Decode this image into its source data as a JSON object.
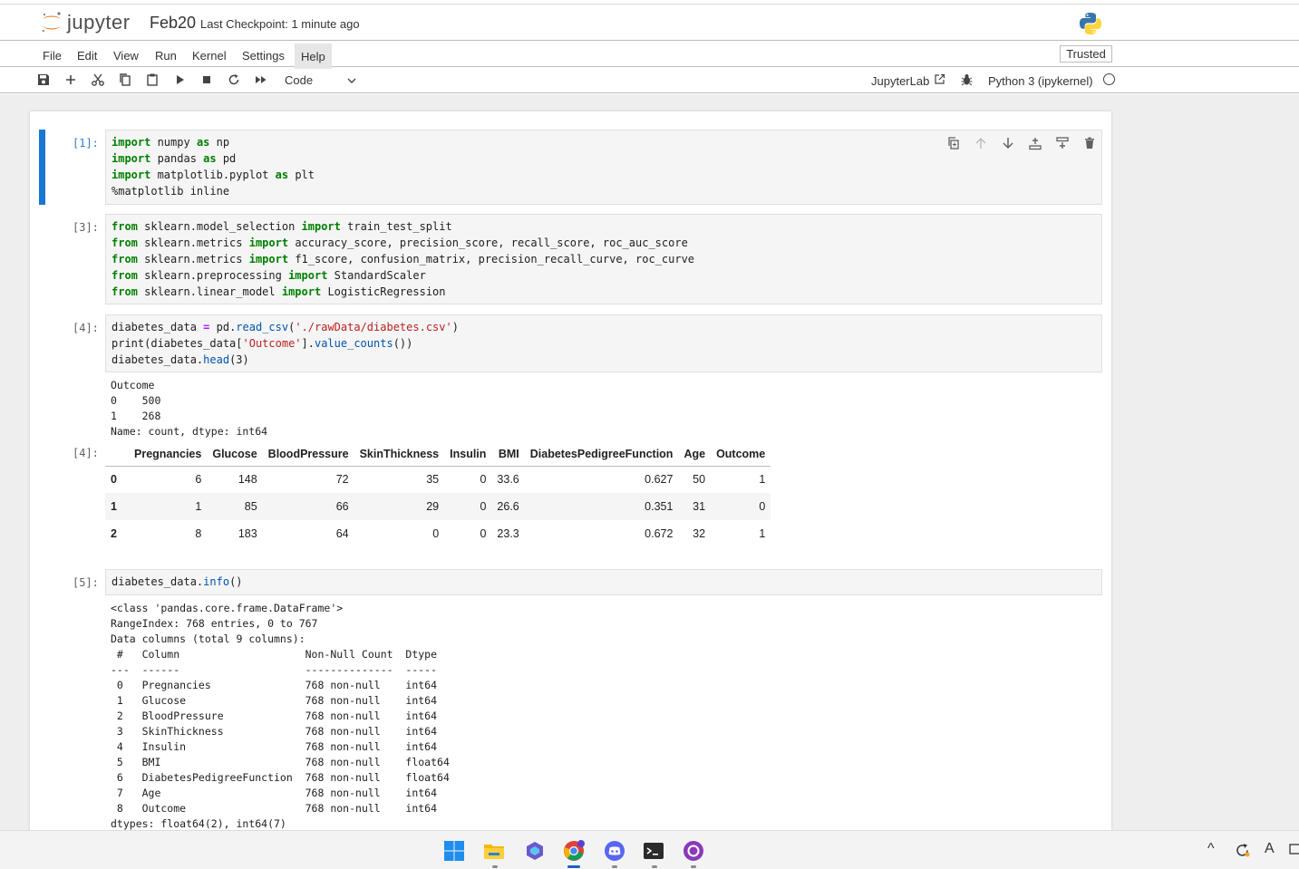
{
  "header": {
    "logo_text": "jupyter",
    "notebook_title": "Feb20",
    "checkpoint": "Last Checkpoint: 1 minute ago"
  },
  "menu": {
    "items": [
      "File",
      "Edit",
      "View",
      "Run",
      "Kernel",
      "Settings",
      "Help"
    ],
    "trusted": "Trusted"
  },
  "toolbar": {
    "cell_type": "Code",
    "jupyterlab_label": "JupyterLab",
    "kernel": "Python 3 (ipykernel)",
    "icons": [
      "save-icon",
      "add-icon",
      "cut-icon",
      "copy-icon",
      "paste-icon",
      "run-icon",
      "stop-icon",
      "restart-icon",
      "fast-forward-icon"
    ]
  },
  "cells": {
    "c1": {
      "prompt": "[1]:",
      "lines": {
        "l1": {
          "a": "import",
          "b": " numpy ",
          "c": "as",
          "d": " np"
        },
        "l2": {
          "a": "import",
          "b": " pandas ",
          "c": "as",
          "d": " pd"
        },
        "l3": {
          "a": "import",
          "b": " matplotlib.pyplot ",
          "c": "as",
          "d": " plt"
        },
        "l4": "%matplotlib inline"
      }
    },
    "c3": {
      "prompt": "[3]:",
      "lines": [
        {
          "from": "from",
          "mod": " sklearn.model_selection ",
          "imp": "import",
          "rest": " train_test_split"
        },
        {
          "from": "from",
          "mod": " sklearn.metrics ",
          "imp": "import",
          "rest": " accuracy_score, precision_score, recall_score, roc_auc_score"
        },
        {
          "from": "from",
          "mod": " sklearn.metrics ",
          "imp": "import",
          "rest": " f1_score, confusion_matrix, precision_recall_curve, roc_curve"
        },
        {
          "from": "from",
          "mod": " sklearn.preprocessing ",
          "imp": "import",
          "rest": " StandardScaler"
        },
        {
          "from": "from",
          "mod": " sklearn.linear_model ",
          "imp": "import",
          "rest": " LogisticRegression"
        }
      ]
    },
    "c4": {
      "prompt": "[4]:",
      "line1": {
        "a": "diabetes_data ",
        "op": "=",
        "b": " pd.",
        "fn": "read_csv",
        "c": "(",
        "str": "'./rawData/diabetes.csv'",
        "d": ")"
      },
      "line2": {
        "a": "print(diabetes_data[",
        "str": "'Outcome'",
        "b": "].",
        "fn": "value_counts",
        "c": "())"
      },
      "line3": {
        "a": "diabetes_data.",
        "fn": "head",
        "b": "(3)"
      },
      "stdout": "Outcome\n0    500\n1    268\nName: count, dtype: int64",
      "out_prompt": "[4]:",
      "table": {
        "columns": [
          "",
          "Pregnancies",
          "Glucose",
          "BloodPressure",
          "SkinThickness",
          "Insulin",
          "BMI",
          "DiabetesPedigreeFunction",
          "Age",
          "Outcome"
        ],
        "rows": [
          [
            "0",
            "6",
            "148",
            "72",
            "35",
            "0",
            "33.6",
            "0.627",
            "50",
            "1"
          ],
          [
            "1",
            "1",
            "85",
            "66",
            "29",
            "0",
            "26.6",
            "0.351",
            "31",
            "0"
          ],
          [
            "2",
            "8",
            "183",
            "64",
            "0",
            "0",
            "23.3",
            "0.672",
            "32",
            "1"
          ]
        ]
      }
    },
    "c5": {
      "prompt": "[5]:",
      "line1": {
        "a": "diabetes_data.",
        "fn": "info",
        "b": "()"
      },
      "stdout": "<class 'pandas.core.frame.DataFrame'>\nRangeIndex: 768 entries, 0 to 767\nData columns (total 9 columns):\n #   Column                    Non-Null Count  Dtype  \n---  ------                    --------------  -----  \n 0   Pregnancies               768 non-null    int64  \n 1   Glucose                   768 non-null    int64  \n 2   BloodPressure             768 non-null    int64  \n 3   SkinThickness             768 non-null    int64  \n 4   Insulin                   768 non-null    int64  \n 5   BMI                       768 non-null    float64\n 6   DiabetesPedigreeFunction  768 non-null    float64\n 7   Age                       768 non-null    int64  \n 8   Outcome                   768 non-null    int64  \ndtypes: float64(2), int64(7)"
    }
  },
  "cell_tools": [
    "duplicate-icon",
    "move-up-icon",
    "move-down-icon",
    "insert-above-icon",
    "insert-below-icon",
    "delete-icon"
  ],
  "taskbar": {
    "apps": [
      "windows-start-icon",
      "file-explorer-icon",
      "copilot-icon",
      "chrome-icon",
      "discord-icon",
      "terminal-icon",
      "github-desktop-icon"
    ],
    "tray": {
      "chevron": "^",
      "lang": "A"
    }
  },
  "colors": {
    "accent": "#1976d2",
    "keyword": "#008000",
    "string": "#ba2121"
  }
}
